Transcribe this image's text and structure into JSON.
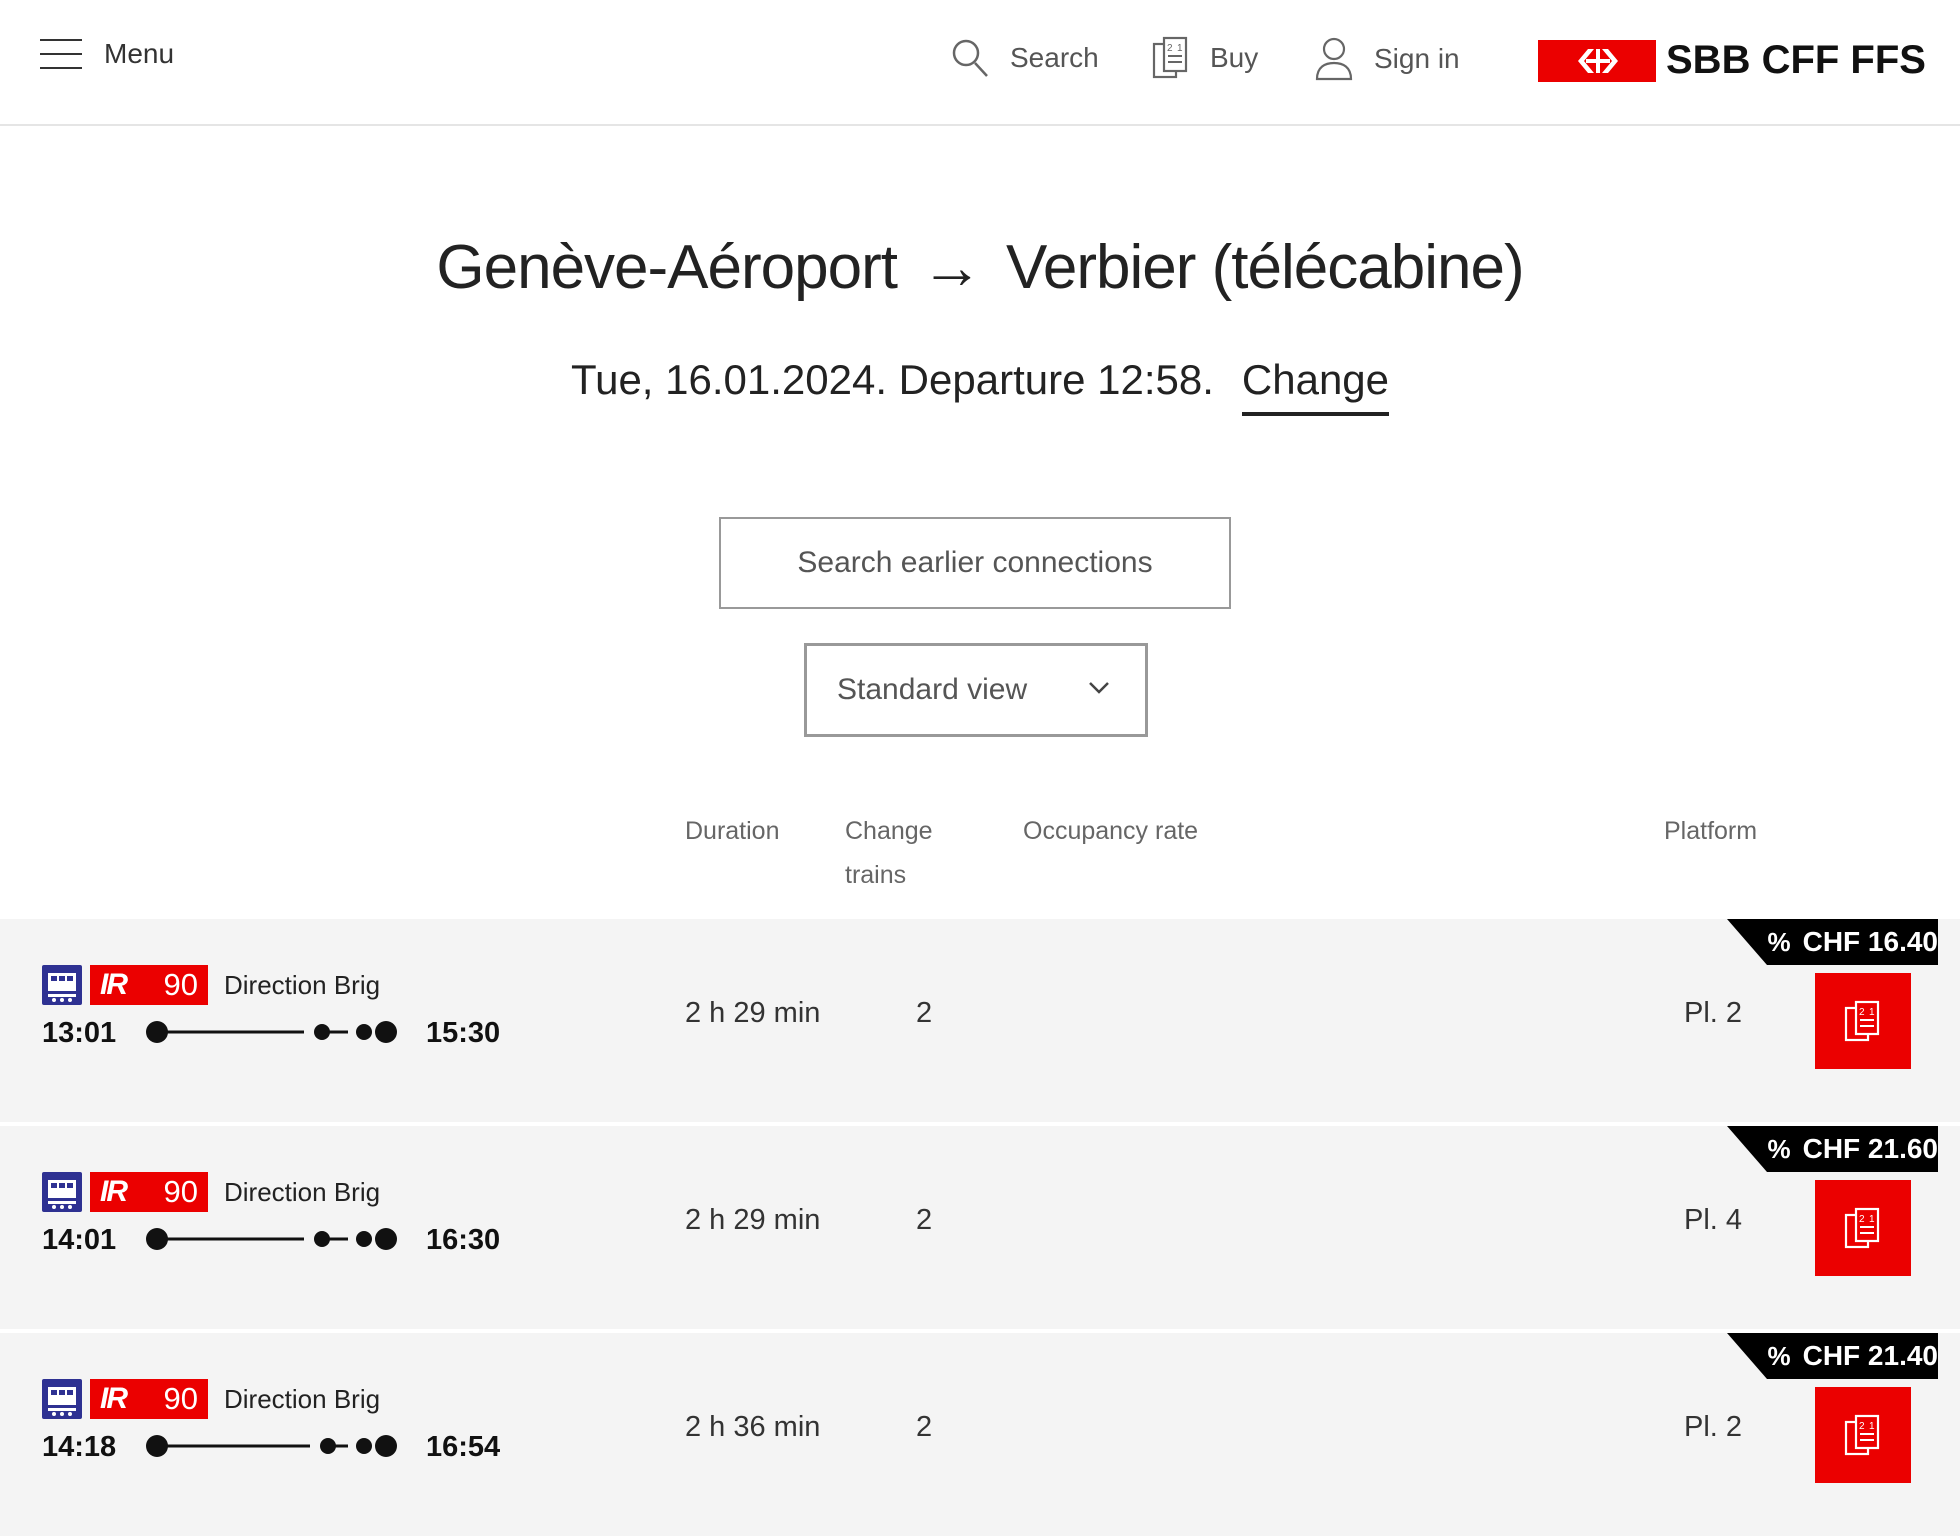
{
  "header": {
    "menu_label": "Menu",
    "search_label": "Search",
    "buy_label": "Buy",
    "signin_label": "Sign in",
    "brand_text": "SBB CFF FFS",
    "brand_color": "#eb0000"
  },
  "journey": {
    "origin": "Genève-Aéroport",
    "arrow": "→",
    "destination": "Verbier (télécabine)",
    "date_line": "Tue, 16.01.2024. Departure 12:58.",
    "change_label": "Change"
  },
  "controls": {
    "earlier_label": "Search earlier connections",
    "view_selected": "Standard view"
  },
  "columns": {
    "duration": "Duration",
    "change_trains_1": "Change",
    "change_trains_2": "trains",
    "occupancy": "Occupancy rate",
    "platform": "Platform"
  },
  "connections": [
    {
      "product": "IR",
      "line": "90",
      "direction": "Direction Brig",
      "departure": "13:01",
      "arrival": "15:30",
      "duration": "2 h 29 min",
      "changes": "2",
      "platform": "Pl. 2",
      "price": "CHF 16.40"
    },
    {
      "product": "IR",
      "line": "90",
      "direction": "Direction Brig",
      "departure": "14:01",
      "arrival": "16:30",
      "duration": "2 h 29 min",
      "changes": "2",
      "platform": "Pl. 4",
      "price": "CHF 21.60"
    },
    {
      "product": "IR",
      "line": "90",
      "direction": "Direction Brig",
      "departure": "14:18",
      "arrival": "16:54",
      "duration": "2 h 36 min",
      "changes": "2",
      "platform": "Pl. 2",
      "price": "CHF 21.40"
    }
  ],
  "icons": {
    "menu": "hamburger-icon",
    "search": "search-icon",
    "buy": "ticket-icon",
    "signin": "user-icon",
    "train": "train-icon",
    "discount": "percent-icon",
    "chevron": "chevron-down-icon"
  },
  "colors": {
    "sbb_red": "#eb0000",
    "train_blue": "#2e3192",
    "row_bg": "#f4f4f4"
  }
}
